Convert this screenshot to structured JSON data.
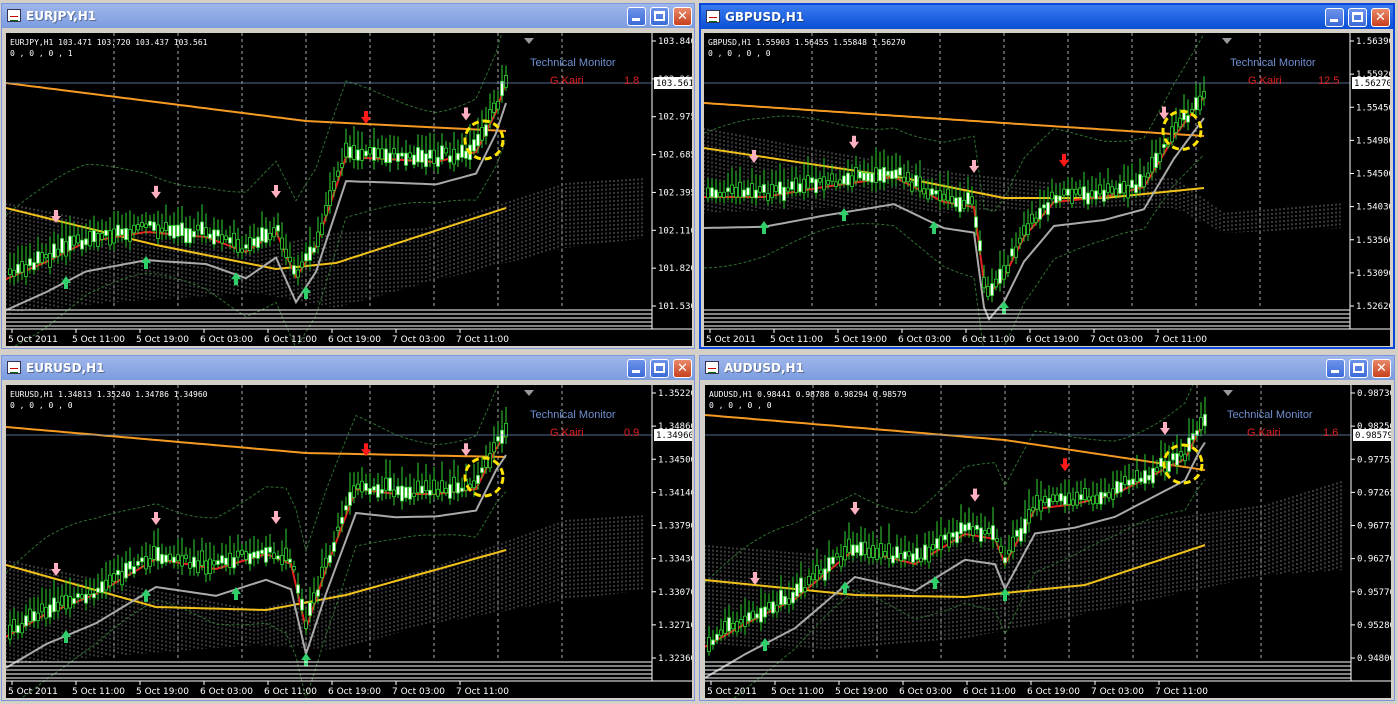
{
  "colors": {
    "ma_orange": "#f59a23",
    "ma_yellow": "#f2c21a",
    "ma_red": "#e62020",
    "ma_gray": "#aaaaaa",
    "bb": "#2f6f2f",
    "candle": "#31d631",
    "circle": "#ffe400",
    "monitor": "#6f8fd0",
    "gkairi": "#e02020"
  },
  "icons": {
    "window": "chart-window-icon",
    "minimize": "minimize-icon",
    "maximize": "maximize-icon",
    "close": "close-icon",
    "shift": "chart-shift-icon",
    "up": "buy-arrow-icon",
    "down": "sell-arrow-icon"
  },
  "windows": [
    {
      "title": "EURJPY,H1",
      "info": "EURJPY,H1  103.471 103.720 103.437 103.561",
      "zeros": "0 , 0 , 0 , 1",
      "monitor_label": "Technical  Monitor",
      "gkairi_label": "G.Kairi",
      "gkairi_value": "1.8",
      "price_labels": [
        "103.840",
        "103.260",
        "102.975",
        "102.685",
        "102.395",
        "102.110",
        "101.820",
        "101.530"
      ],
      "current_price": "103.561",
      "time_labels": [
        "5 Oct 2011",
        "5 Oct 11:00",
        "5 Oct 19:00",
        "6 Oct 03:00",
        "6 Oct 11:00",
        "6 Oct 19:00",
        "7 Oct 03:00",
        "7 Oct 11:00"
      ]
    },
    {
      "title": "GBPUSD,H1",
      "info": "GBPUSD,H1  1.55903 1.56455 1.55848 1.56270",
      "zeros": "0 , 0 , 0 , 0",
      "monitor_label": "Technical  Monitor",
      "gkairi_label": "G.Kairi",
      "gkairi_value": "12.5",
      "price_labels": [
        "1.56390",
        "1.55920",
        "1.55450",
        "1.54980",
        "1.54500",
        "1.54030",
        "1.53560",
        "1.53090",
        "1.52620"
      ],
      "current_price": "1.56270",
      "time_labels": [
        "5 Oct 2011",
        "5 Oct 11:00",
        "5 Oct 19:00",
        "6 Oct 03:00",
        "6 Oct 11:00",
        "6 Oct 19:00",
        "7 Oct 03:00",
        "7 Oct 11:00"
      ]
    },
    {
      "title": "EURUSD,H1",
      "info": "EURUSD,H1  1.34813 1.35240 1.34786 1.34960",
      "zeros": "0 , 0 , 0 , 0",
      "monitor_label": "Technical  Monitor",
      "gkairi_label": "G.Kairi",
      "gkairi_value": "0.9",
      "price_labels": [
        "1.35220",
        "1.34860",
        "1.34500",
        "1.34140",
        "1.33790",
        "1.33430",
        "1.33070",
        "1.32710",
        "1.32360"
      ],
      "current_price": "1.34960",
      "time_labels": [
        "5 Oct 2011",
        "5 Oct 11:00",
        "5 Oct 19:00",
        "6 Oct 03:00",
        "6 Oct 11:00",
        "6 Oct 19:00",
        "7 Oct 03:00",
        "7 Oct 11:00"
      ]
    },
    {
      "title": "AUDUSD,H1",
      "info": "AUDUSD,H1  0.98441 0.98788 0.98294 0.98579",
      "zeros": "0 , 0 , 0 , 0",
      "monitor_label": "Technical  Monitor",
      "gkairi_label": "G.Kairi",
      "gkairi_value": "1.6",
      "price_labels": [
        "0.98730",
        "0.98250",
        "0.97755",
        "0.97265",
        "0.96775",
        "0.96270",
        "0.95770",
        "0.95280",
        "0.94800"
      ],
      "current_price": "0.98579",
      "time_labels": [
        "5 Oct 2011",
        "5 Oct 11:00",
        "5 Oct 19:00",
        "6 Oct 03:00",
        "6 Oct 11:00",
        "6 Oct 19:00",
        "7 Oct 03:00",
        "7 Oct 11:00"
      ]
    }
  ]
}
